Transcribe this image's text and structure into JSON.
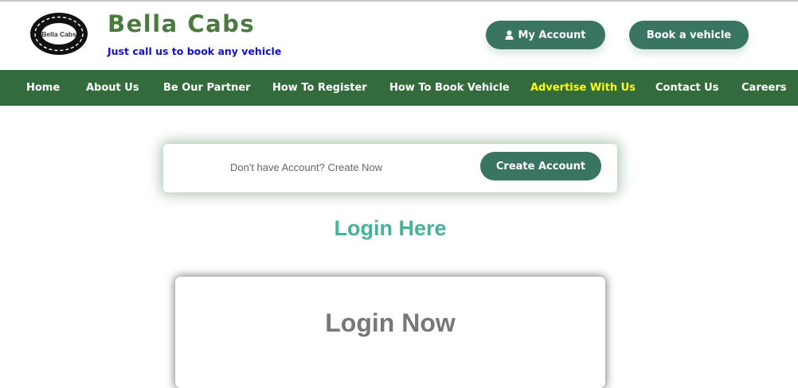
{
  "brand": {
    "logo_text": "Bella Cabs",
    "title": "Bella Cabs",
    "tagline": "Just call us to book any vehicle"
  },
  "header_buttons": {
    "my_account": "My Account",
    "book_vehicle": "Book a vehicle"
  },
  "nav": {
    "items": [
      {
        "label": "Home"
      },
      {
        "label": "About Us"
      },
      {
        "label": "Be Our Partner"
      },
      {
        "label": "How To Register"
      },
      {
        "label": "How To Book Vehicle"
      },
      {
        "label": "Advertise With Us"
      },
      {
        "label": "Contact Us"
      },
      {
        "label": "Careers"
      }
    ]
  },
  "create_account": {
    "prompt": "Don't have Account? Create Now",
    "button": "Create Account"
  },
  "login": {
    "heading": "Login Here",
    "card_title": "Login Now"
  },
  "colors": {
    "brand_green": "#4a7a3e",
    "nav_bg": "#336b3d",
    "button_bg": "#3a7462",
    "tagline": "#1010d0",
    "nav_highlight": "#ffff00",
    "heading_teal": "#45b39a"
  },
  "icons": {
    "my_account": "user-icon",
    "logo": "road-ring-logo"
  }
}
